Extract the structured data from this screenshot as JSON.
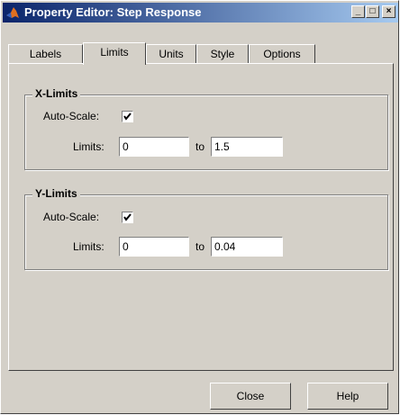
{
  "window": {
    "title": "Property Editor: Step Response",
    "controls": {
      "minimize": "_",
      "maximize": "□",
      "close": "×"
    }
  },
  "tabs": [
    {
      "label": "Labels",
      "active": false
    },
    {
      "label": "Limits",
      "active": true
    },
    {
      "label": "Units",
      "active": false
    },
    {
      "label": "Style",
      "active": false
    },
    {
      "label": "Options",
      "active": false
    }
  ],
  "x_limits": {
    "title": "X-Limits",
    "auto_scale_label": "Auto-Scale:",
    "auto_scale_checked": true,
    "limits_label": "Limits:",
    "from": "0",
    "to_label": "to",
    "to": "1.5"
  },
  "y_limits": {
    "title": "Y-Limits",
    "auto_scale_label": "Auto-Scale:",
    "auto_scale_checked": true,
    "limits_label": "Limits:",
    "from": "0",
    "to_label": "to",
    "to": "0.04"
  },
  "buttons": {
    "close": "Close",
    "help": "Help"
  },
  "colors": {
    "titlebar_start": "#0a246a",
    "titlebar_end": "#a6caf0",
    "face": "#d4d0c8"
  }
}
